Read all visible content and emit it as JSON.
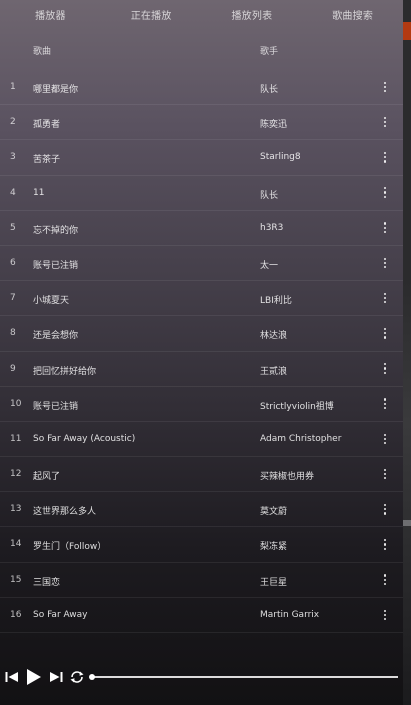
{
  "tabs": [
    {
      "label": "播放器"
    },
    {
      "label": "正在播放"
    },
    {
      "label": "播放列表"
    },
    {
      "label": "歌曲搜索"
    }
  ],
  "header": {
    "song": "歌曲",
    "artist": "歌手"
  },
  "songs": [
    {
      "num": "1",
      "title": "哪里都是你",
      "artist": "队长"
    },
    {
      "num": "2",
      "title": "孤勇者",
      "artist": "陈奕迅"
    },
    {
      "num": "3",
      "title": "苦茶子",
      "artist": "Starling8"
    },
    {
      "num": "4",
      "title": "11",
      "artist": "队长"
    },
    {
      "num": "5",
      "title": "忘不掉的你",
      "artist": "h3R3"
    },
    {
      "num": "6",
      "title": "账号已注销",
      "artist": "太一"
    },
    {
      "num": "7",
      "title": "小城夏天",
      "artist": "LBI利比"
    },
    {
      "num": "8",
      "title": "还是会想你",
      "artist": "林达浪"
    },
    {
      "num": "9",
      "title": "把回忆拼好给你",
      "artist": "王贰浪"
    },
    {
      "num": "10",
      "title": "账号已注销",
      "artist": "Strictlyviolin祖博"
    },
    {
      "num": "11",
      "title": "So Far Away (Acoustic)",
      "artist": "Adam Christopher"
    },
    {
      "num": "12",
      "title": "起风了",
      "artist": "买辣椒也用券"
    },
    {
      "num": "13",
      "title": "这世界那么多人",
      "artist": "莫文蔚"
    },
    {
      "num": "14",
      "title": "罗生门（Follow）",
      "artist": "梨冻紧"
    },
    {
      "num": "15",
      "title": "三国恋",
      "artist": "王巨星"
    },
    {
      "num": "16",
      "title": "So Far Away",
      "artist": "Martin Garrix"
    }
  ],
  "player": {
    "progress": 0.0
  },
  "colors": {
    "accent_edge": "#b33a12",
    "text": "#ffffff"
  },
  "icons": {
    "previous": "skip-previous-icon",
    "play": "play-icon",
    "next": "skip-next-icon",
    "repeat": "repeat-icon",
    "more": "more-vertical-icon"
  }
}
